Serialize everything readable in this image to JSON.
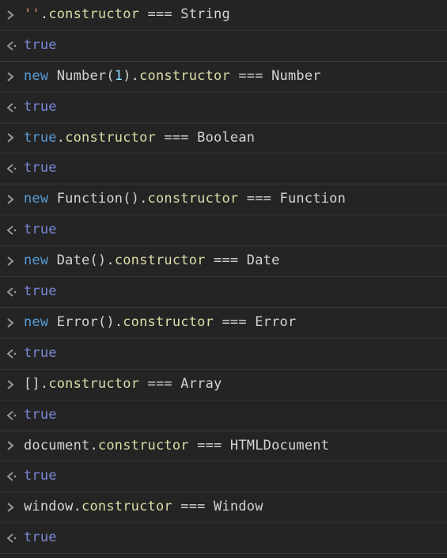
{
  "entries": [
    {
      "input": [
        {
          "cls": "tok-str",
          "t": "''"
        },
        {
          "cls": "tok-punct",
          "t": "."
        },
        {
          "cls": "tok-prop",
          "t": "constructor"
        },
        {
          "cls": "tok-plain",
          "t": " "
        },
        {
          "cls": "tok-op",
          "t": "==="
        },
        {
          "cls": "tok-plain",
          "t": " "
        },
        {
          "cls": "tok-type",
          "t": "String"
        }
      ],
      "output": [
        {
          "cls": "tok-result",
          "t": "true"
        }
      ]
    },
    {
      "input": [
        {
          "cls": "tok-kw",
          "t": "new"
        },
        {
          "cls": "tok-plain",
          "t": " "
        },
        {
          "cls": "tok-type",
          "t": "Number"
        },
        {
          "cls": "tok-punct",
          "t": "("
        },
        {
          "cls": "tok-num",
          "t": "1"
        },
        {
          "cls": "tok-punct",
          "t": ")"
        },
        {
          "cls": "tok-punct",
          "t": "."
        },
        {
          "cls": "tok-prop",
          "t": "constructor"
        },
        {
          "cls": "tok-plain",
          "t": " "
        },
        {
          "cls": "tok-op",
          "t": "==="
        },
        {
          "cls": "tok-plain",
          "t": " "
        },
        {
          "cls": "tok-type",
          "t": "Number"
        }
      ],
      "output": [
        {
          "cls": "tok-result",
          "t": "true"
        }
      ]
    },
    {
      "input": [
        {
          "cls": "tok-bool",
          "t": "true"
        },
        {
          "cls": "tok-punct",
          "t": "."
        },
        {
          "cls": "tok-prop",
          "t": "constructor"
        },
        {
          "cls": "tok-plain",
          "t": " "
        },
        {
          "cls": "tok-op",
          "t": "==="
        },
        {
          "cls": "tok-plain",
          "t": " "
        },
        {
          "cls": "tok-type",
          "t": "Boolean"
        }
      ],
      "output": [
        {
          "cls": "tok-result",
          "t": "true"
        }
      ]
    },
    {
      "input": [
        {
          "cls": "tok-kw",
          "t": "new"
        },
        {
          "cls": "tok-plain",
          "t": " "
        },
        {
          "cls": "tok-type",
          "t": "Function"
        },
        {
          "cls": "tok-punct",
          "t": "()"
        },
        {
          "cls": "tok-punct",
          "t": "."
        },
        {
          "cls": "tok-prop",
          "t": "constructor"
        },
        {
          "cls": "tok-plain",
          "t": " "
        },
        {
          "cls": "tok-op",
          "t": "==="
        },
        {
          "cls": "tok-plain",
          "t": " "
        },
        {
          "cls": "tok-type",
          "t": "Function"
        }
      ],
      "output": [
        {
          "cls": "tok-result",
          "t": "true"
        }
      ]
    },
    {
      "input": [
        {
          "cls": "tok-kw",
          "t": "new"
        },
        {
          "cls": "tok-plain",
          "t": " "
        },
        {
          "cls": "tok-type",
          "t": "Date"
        },
        {
          "cls": "tok-punct",
          "t": "()"
        },
        {
          "cls": "tok-punct",
          "t": "."
        },
        {
          "cls": "tok-prop",
          "t": "constructor"
        },
        {
          "cls": "tok-plain",
          "t": " "
        },
        {
          "cls": "tok-op",
          "t": "==="
        },
        {
          "cls": "tok-plain",
          "t": " "
        },
        {
          "cls": "tok-type",
          "t": "Date"
        }
      ],
      "output": [
        {
          "cls": "tok-result",
          "t": "true"
        }
      ]
    },
    {
      "input": [
        {
          "cls": "tok-kw",
          "t": "new"
        },
        {
          "cls": "tok-plain",
          "t": " "
        },
        {
          "cls": "tok-type",
          "t": "Error"
        },
        {
          "cls": "tok-punct",
          "t": "()"
        },
        {
          "cls": "tok-punct",
          "t": "."
        },
        {
          "cls": "tok-prop",
          "t": "constructor"
        },
        {
          "cls": "tok-plain",
          "t": " "
        },
        {
          "cls": "tok-op",
          "t": "==="
        },
        {
          "cls": "tok-plain",
          "t": " "
        },
        {
          "cls": "tok-type",
          "t": "Error"
        }
      ],
      "output": [
        {
          "cls": "tok-result",
          "t": "true"
        }
      ]
    },
    {
      "input": [
        {
          "cls": "tok-punct",
          "t": "[]"
        },
        {
          "cls": "tok-punct",
          "t": "."
        },
        {
          "cls": "tok-prop",
          "t": "constructor"
        },
        {
          "cls": "tok-plain",
          "t": " "
        },
        {
          "cls": "tok-op",
          "t": "==="
        },
        {
          "cls": "tok-plain",
          "t": " "
        },
        {
          "cls": "tok-type",
          "t": "Array"
        }
      ],
      "output": [
        {
          "cls": "tok-result",
          "t": "true"
        }
      ]
    },
    {
      "input": [
        {
          "cls": "tok-plain",
          "t": "document"
        },
        {
          "cls": "tok-punct",
          "t": "."
        },
        {
          "cls": "tok-prop",
          "t": "constructor"
        },
        {
          "cls": "tok-plain",
          "t": " "
        },
        {
          "cls": "tok-op",
          "t": "==="
        },
        {
          "cls": "tok-plain",
          "t": " "
        },
        {
          "cls": "tok-type",
          "t": "HTMLDocument"
        }
      ],
      "output": [
        {
          "cls": "tok-result",
          "t": "true"
        }
      ]
    },
    {
      "input": [
        {
          "cls": "tok-plain",
          "t": "window"
        },
        {
          "cls": "tok-punct",
          "t": "."
        },
        {
          "cls": "tok-prop",
          "t": "constructor"
        },
        {
          "cls": "tok-plain",
          "t": " "
        },
        {
          "cls": "tok-op",
          "t": "==="
        },
        {
          "cls": "tok-plain",
          "t": " "
        },
        {
          "cls": "tok-type",
          "t": "Window"
        }
      ],
      "output": [
        {
          "cls": "tok-result",
          "t": "true"
        }
      ]
    }
  ]
}
